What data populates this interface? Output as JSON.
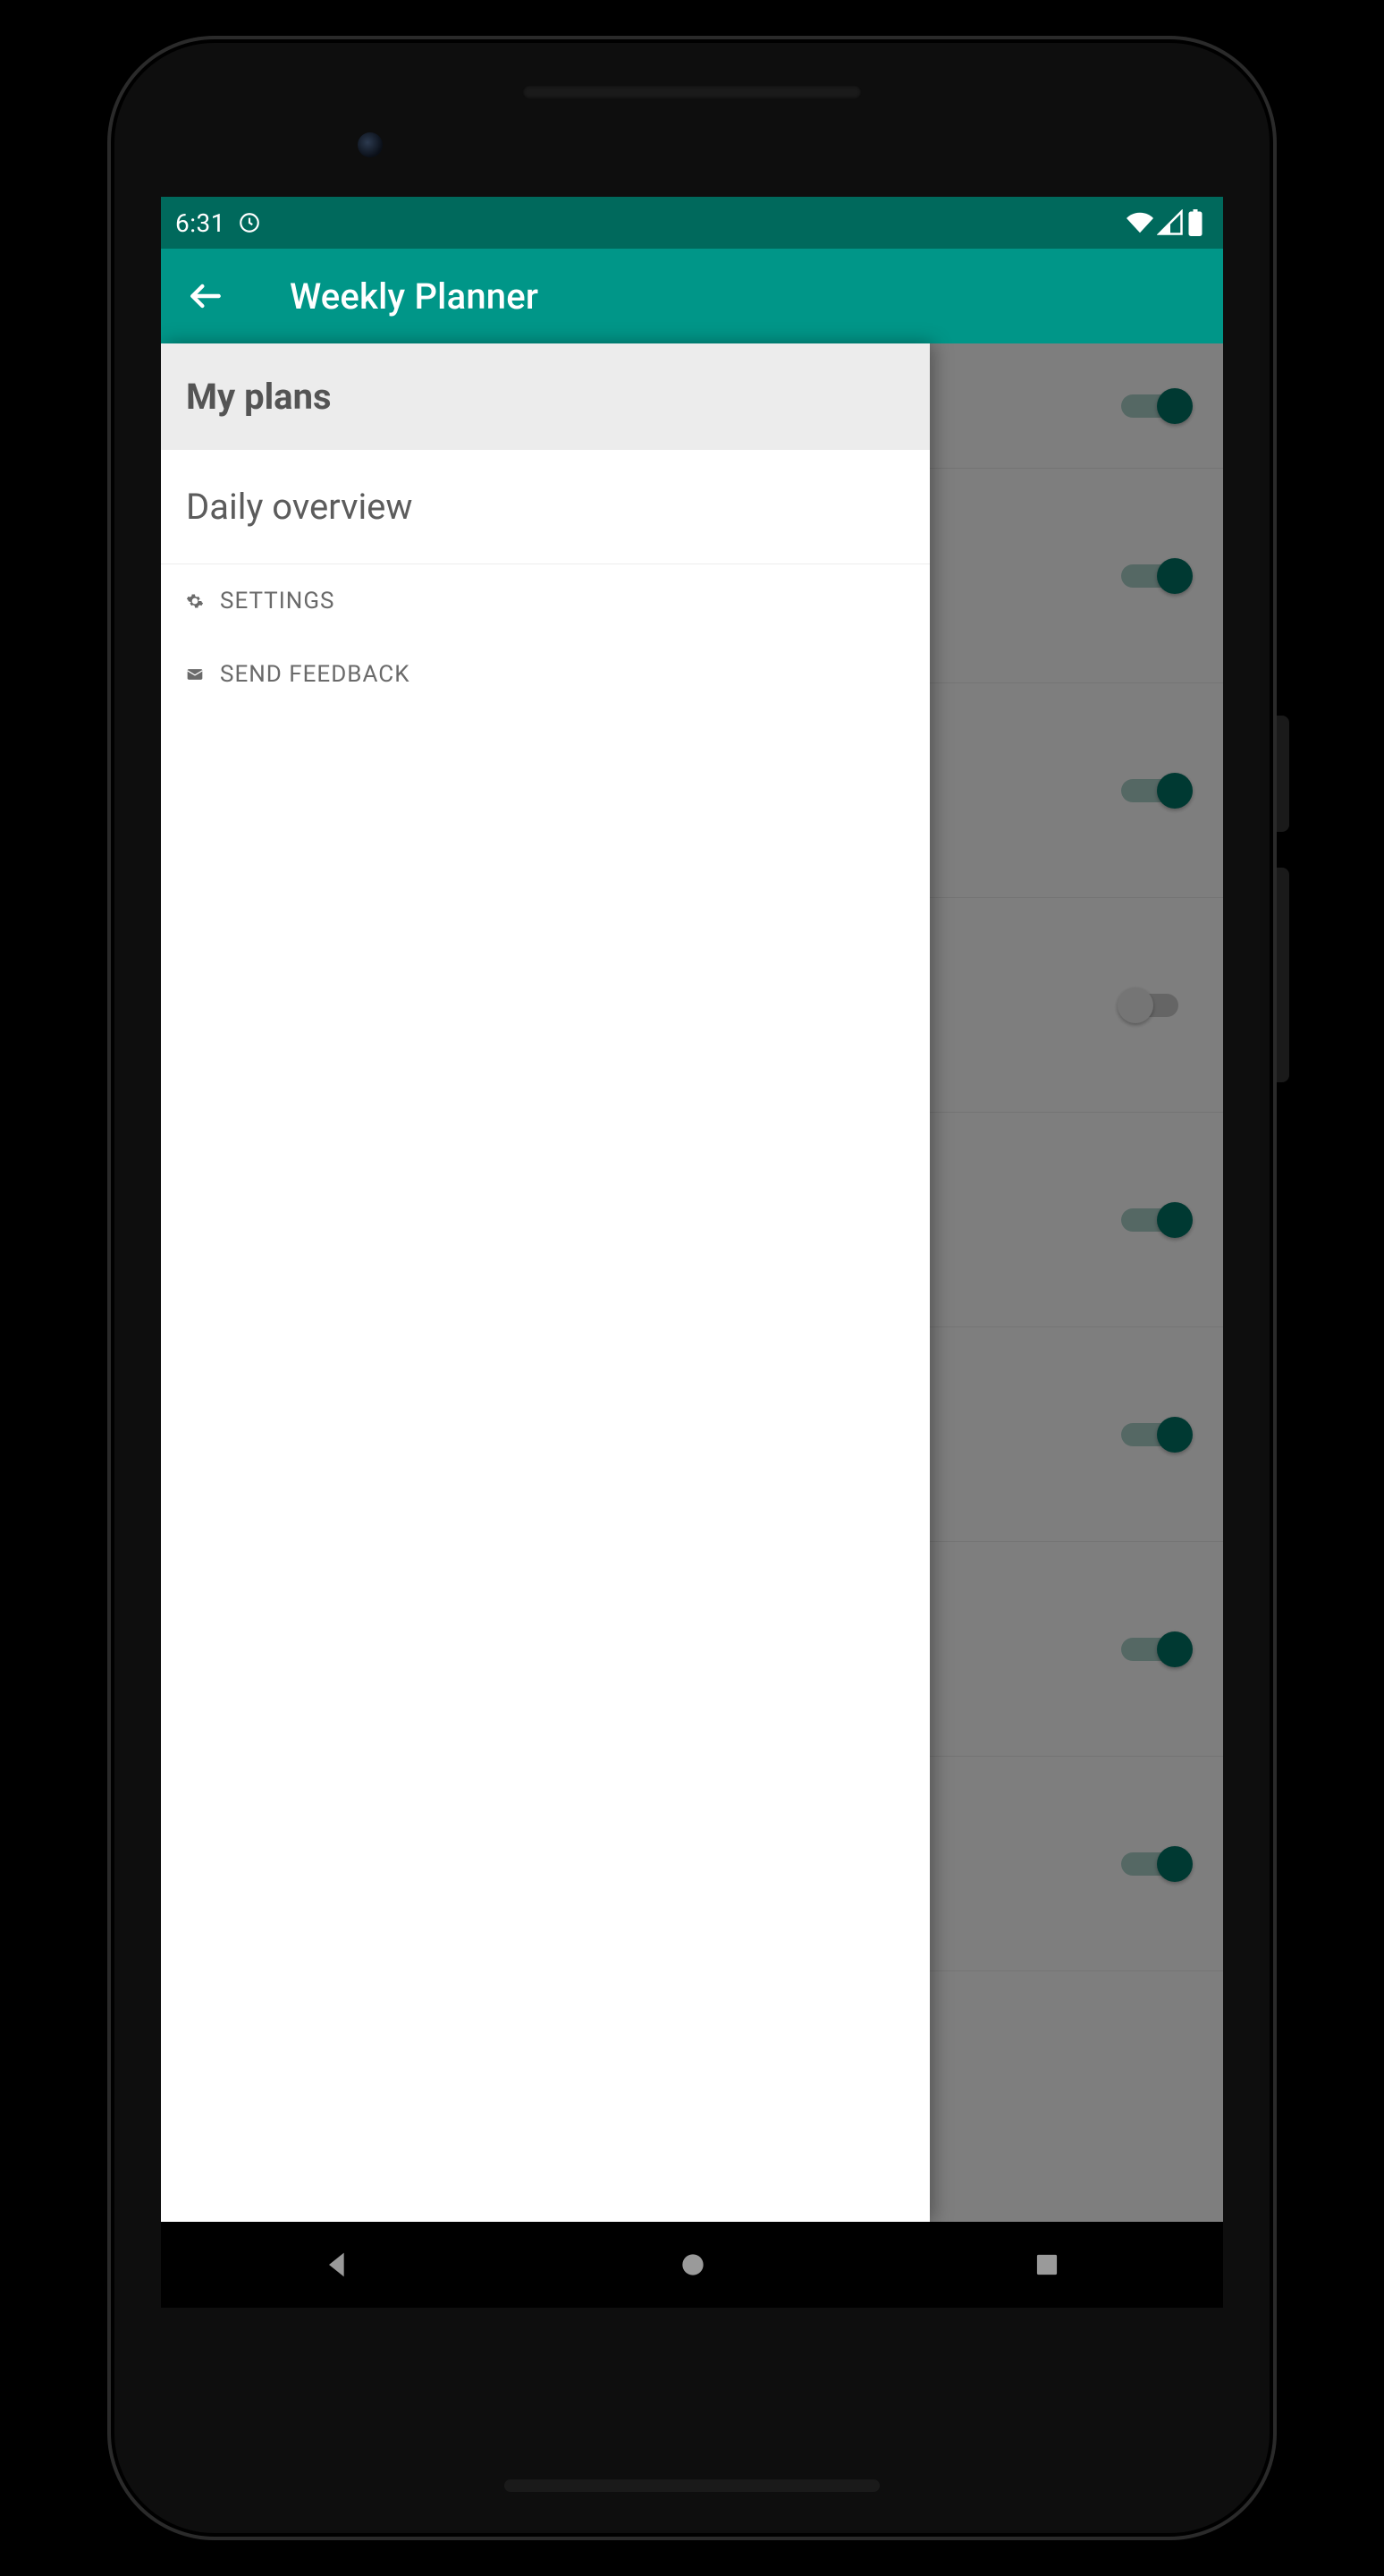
{
  "status": {
    "time": "6:31"
  },
  "app": {
    "title": "Weekly Planner"
  },
  "drawer": {
    "header": "My plans",
    "main_item": "Daily overview",
    "settings_label": "SETTINGS",
    "feedback_label": "SEND FEEDBACK"
  },
  "toggles": [
    {
      "on": true
    },
    {
      "on": true
    },
    {
      "on": true
    },
    {
      "on": false
    },
    {
      "on": true
    },
    {
      "on": true
    },
    {
      "on": true
    },
    {
      "on": true
    }
  ],
  "colors": {
    "accent": "#009688",
    "accent_dark": "#00695c"
  }
}
